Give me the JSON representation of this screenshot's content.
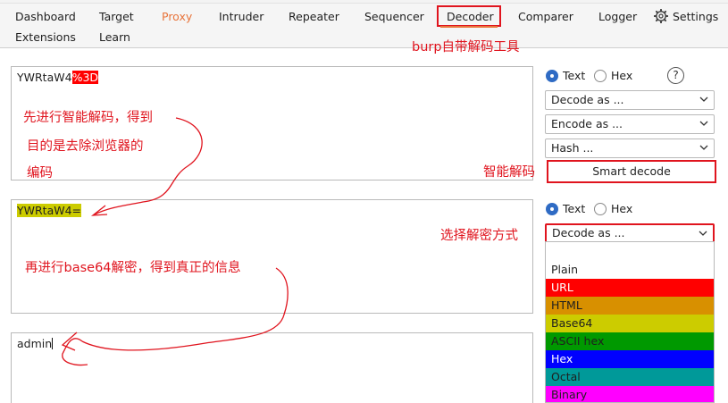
{
  "tabs": {
    "dashboard": "Dashboard",
    "target": "Target",
    "proxy": "Proxy",
    "intruder": "Intruder",
    "repeater": "Repeater",
    "sequencer": "Sequencer",
    "decoder": "Decoder",
    "comparer": "Comparer",
    "logger": "Logger",
    "settings": "Settings",
    "extensions": "Extensions",
    "learn": "Learn"
  },
  "annotations": {
    "tool_note": "burp自带解码工具",
    "step1_line1": "先进行智能解码，得到",
    "step1_line2": "目的是去除浏览器的",
    "step1_line3": "编码",
    "smart_note": "智能解码",
    "select_note": "选择解密方式",
    "step2": "再进行base64解密，得到真正的信息"
  },
  "panel1": {
    "text_plain": "YWRtaW4",
    "text_hl": "%3D"
  },
  "panel2": {
    "text_hl": "YWRtaW4="
  },
  "panel3": {
    "text": "admin"
  },
  "controls1": {
    "text_radio": "Text",
    "hex_radio": "Hex",
    "help": "?",
    "decode_as": "Decode as ...",
    "encode_as": "Encode as ...",
    "hash": "Hash ...",
    "smart_decode": "Smart decode"
  },
  "controls2": {
    "text_radio": "Text",
    "hex_radio": "Hex",
    "decode_as": "Decode as ..."
  },
  "dropdown_options": [
    {
      "label": "Plain",
      "color": "#ffffff",
      "text_color": "#1f1f1f"
    },
    {
      "label": "URL",
      "color": "#ff0000",
      "text_color": "#ffffff"
    },
    {
      "label": "HTML",
      "color": "#d89000",
      "text_color": "#1f1f1f"
    },
    {
      "label": "Base64",
      "color": "#cccc00",
      "text_color": "#1f1f1f"
    },
    {
      "label": "ASCII hex",
      "color": "#009900",
      "text_color": "#1f1f1f"
    },
    {
      "label": "Hex",
      "color": "#0000ff",
      "text_color": "#ffffff"
    },
    {
      "label": "Octal",
      "color": "#009999",
      "text_color": "#1f1f1f"
    },
    {
      "label": "Binary",
      "color": "#ff00ff",
      "text_color": "#1f1f1f"
    }
  ],
  "colors": {
    "annotation_red": "#e0141e",
    "proxy_orange": "#e8743b",
    "radio_blue": "#2f6bc4"
  }
}
